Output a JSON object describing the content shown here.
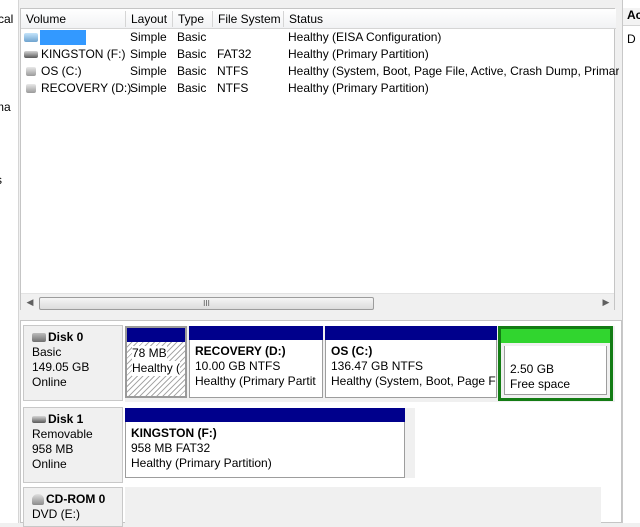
{
  "left_panel": {
    "fragments": [
      "cal",
      "ma",
      "s"
    ]
  },
  "right_panel": {
    "header": "Ac",
    "row": "D"
  },
  "volume_list": {
    "columns": [
      "Volume",
      "Layout",
      "Type",
      "File System",
      "Status"
    ],
    "rows": [
      {
        "volume": "",
        "layout": "Simple",
        "type": "Basic",
        "fs": "",
        "status": "Healthy (EISA Configuration)"
      },
      {
        "volume": "KINGSTON (F:)",
        "layout": "Simple",
        "type": "Basic",
        "fs": "FAT32",
        "status": "Healthy (Primary Partition)"
      },
      {
        "volume": "OS (C:)",
        "layout": "Simple",
        "type": "Basic",
        "fs": "NTFS",
        "status": "Healthy (System, Boot, Page File, Active, Crash Dump, Primary"
      },
      {
        "volume": "RECOVERY (D:)",
        "layout": "Simple",
        "type": "Basic",
        "fs": "NTFS",
        "status": "Healthy (Primary Partition)"
      }
    ],
    "scroll_grip": "III"
  },
  "disks": [
    {
      "name": "Disk 0",
      "type": "Basic",
      "size": "149.05 GB",
      "state": "Online",
      "partitions": [
        {
          "name": "",
          "size": "78 MB",
          "status": "Healthy (",
          "style": "hatched"
        },
        {
          "name": "RECOVERY  (D:)",
          "size": "10.00 GB NTFS",
          "status": "Healthy (Primary Partit",
          "style": "primary"
        },
        {
          "name": "OS  (C:)",
          "size": "136.47 GB NTFS",
          "status": "Healthy (System, Boot, Page F",
          "style": "primary"
        },
        {
          "name": "",
          "size": "2.50 GB",
          "status": "Free space",
          "style": "free"
        }
      ]
    },
    {
      "name": "Disk 1",
      "type": "Removable",
      "size": "958 MB",
      "state": "Online",
      "partitions": [
        {
          "name": "KINGSTON  (F:)",
          "size": "958 MB FAT32",
          "status": "Healthy (Primary Partition)",
          "style": "primary"
        }
      ]
    },
    {
      "name": "CD-ROM 0",
      "type": "DVD (E:)"
    }
  ],
  "colors": {
    "primary_bar": "#00008c",
    "free_bar": "#31d52f",
    "free_border": "#137c14",
    "selection": "#3399ff"
  }
}
